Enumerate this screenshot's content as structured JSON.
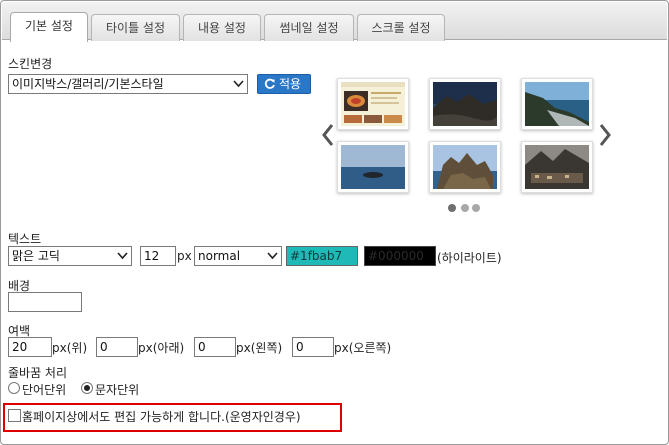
{
  "tabs": [
    {
      "label": "기본 설정",
      "active": true
    },
    {
      "label": "타이틀 설정",
      "active": false
    },
    {
      "label": "내용 설정",
      "active": false
    },
    {
      "label": "썸네일 설정",
      "active": false
    },
    {
      "label": "스크롤 설정",
      "active": false
    }
  ],
  "skin": {
    "section_label": "스킨변경",
    "selected": "이미지박스/갤러리/기본스타일",
    "apply_label": "적용",
    "thumbnails_page": 1,
    "thumbnails_pages": 3
  },
  "text": {
    "section_label": "텍스트",
    "font_selected": "맑은 고딕",
    "size_value": "12",
    "size_unit": "px",
    "weight_selected": "normal",
    "color_value": "#1fbab7",
    "highlight_value": "#000000",
    "highlight_label": "(하이라이트)"
  },
  "background": {
    "section_label": "배경",
    "value": ""
  },
  "margin": {
    "section_label": "여백",
    "top_value": "20",
    "top_label": "px(위)",
    "bottom_value": "0",
    "bottom_label": "px(아래)",
    "left_value": "0",
    "left_label": "px(왼쪽)",
    "right_value": "0",
    "right_label": "px(오른쪽)"
  },
  "linebreak": {
    "section_label": "줄바꿈 처리",
    "option_word": "단어단위",
    "option_char": "문자단위",
    "selected": "문자단위"
  },
  "homepage_edit": {
    "label": "홈페이지상에서도 편집 가능하게 합니다.(운영자인경우)",
    "checked": false
  },
  "colors": {
    "accent": "#2a77c7",
    "text_color_swatch": "#1fbab7",
    "highlight_swatch": "#000000",
    "outline": "#dd0000"
  }
}
